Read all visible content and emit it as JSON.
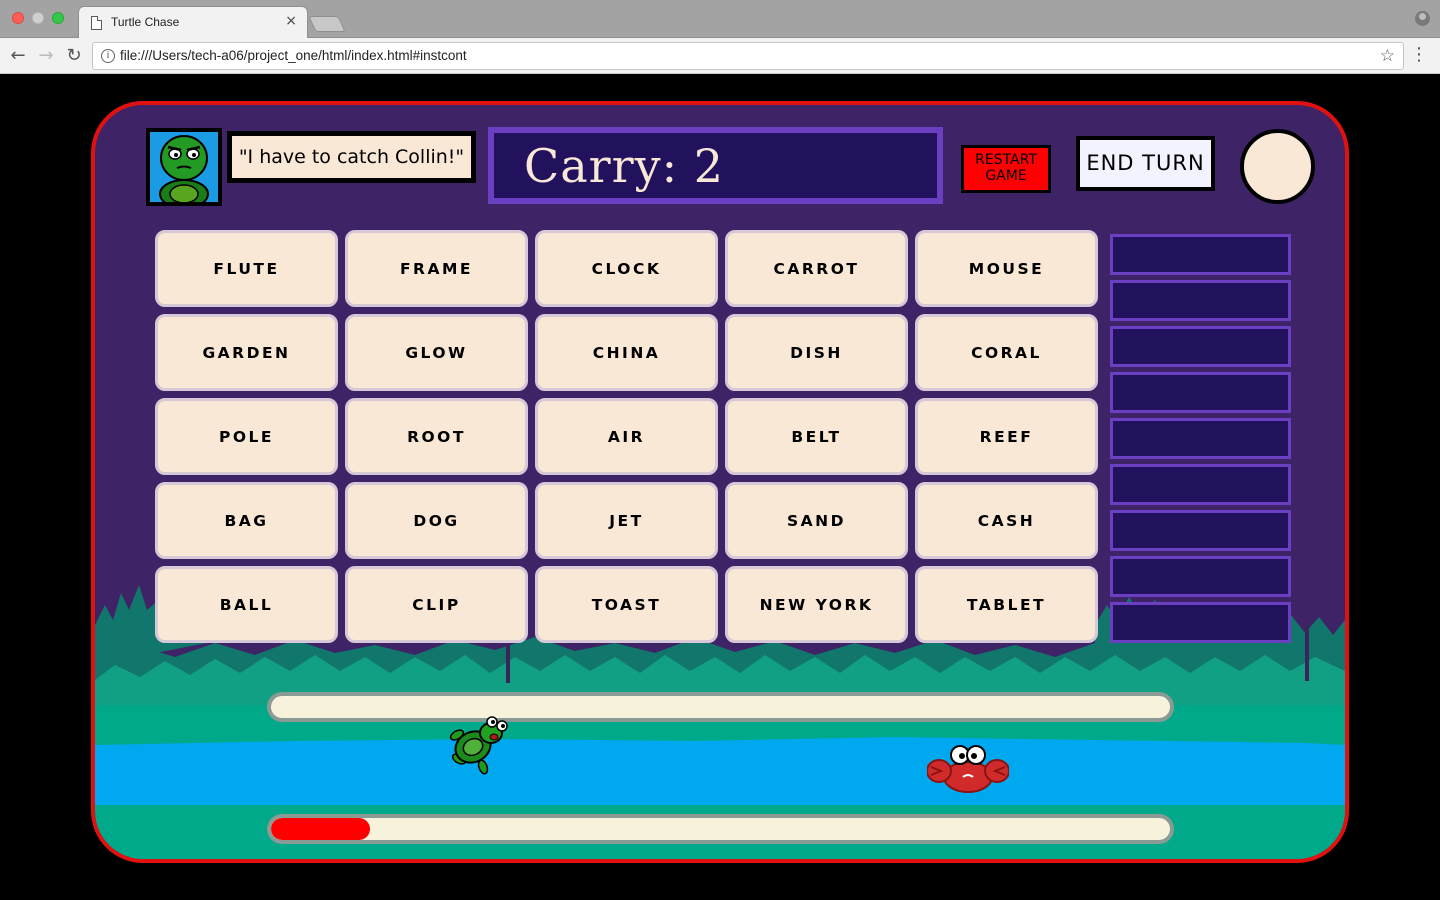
{
  "browser": {
    "tab_title": "Turtle Chase",
    "tab_close": "×",
    "url": "file:///Users/tech-a06/project_one/html/index.html#instcont",
    "back": "←",
    "forward": "→",
    "reload": "↻",
    "info": "i",
    "star": "☆",
    "menu": "⋮"
  },
  "game": {
    "speech": "\"I have to catch Collin!\"",
    "carry_label": "Carry: 2",
    "restart_label": "RESTART GAME",
    "end_turn_label": "END TURN",
    "progress_fraction": 0.11,
    "colors": {
      "board_border": "#e21111",
      "board_bg": "#3e2466",
      "card_bg": "#f9e8d6",
      "restart": "#ff0000",
      "slot_bg": "#22125e",
      "slot_border": "#6b3fc2",
      "water": "#00a8f0",
      "land": "#00a98a",
      "progress": "#ff0000"
    },
    "cards": [
      [
        "FLUTE",
        "FRAME",
        "CLOCK",
        "CARROT",
        "MOUSE"
      ],
      [
        "GARDEN",
        "GLOW",
        "CHINA",
        "DISH",
        "CORAL"
      ],
      [
        "POLE",
        "ROOT",
        "AIR",
        "BELT",
        "REEF"
      ],
      [
        "BAG",
        "DOG",
        "JET",
        "SAND",
        "CASH"
      ],
      [
        "BALL",
        "CLIP",
        "TOAST",
        "NEW YORK",
        "TABLET"
      ]
    ],
    "slot_count": 9
  }
}
